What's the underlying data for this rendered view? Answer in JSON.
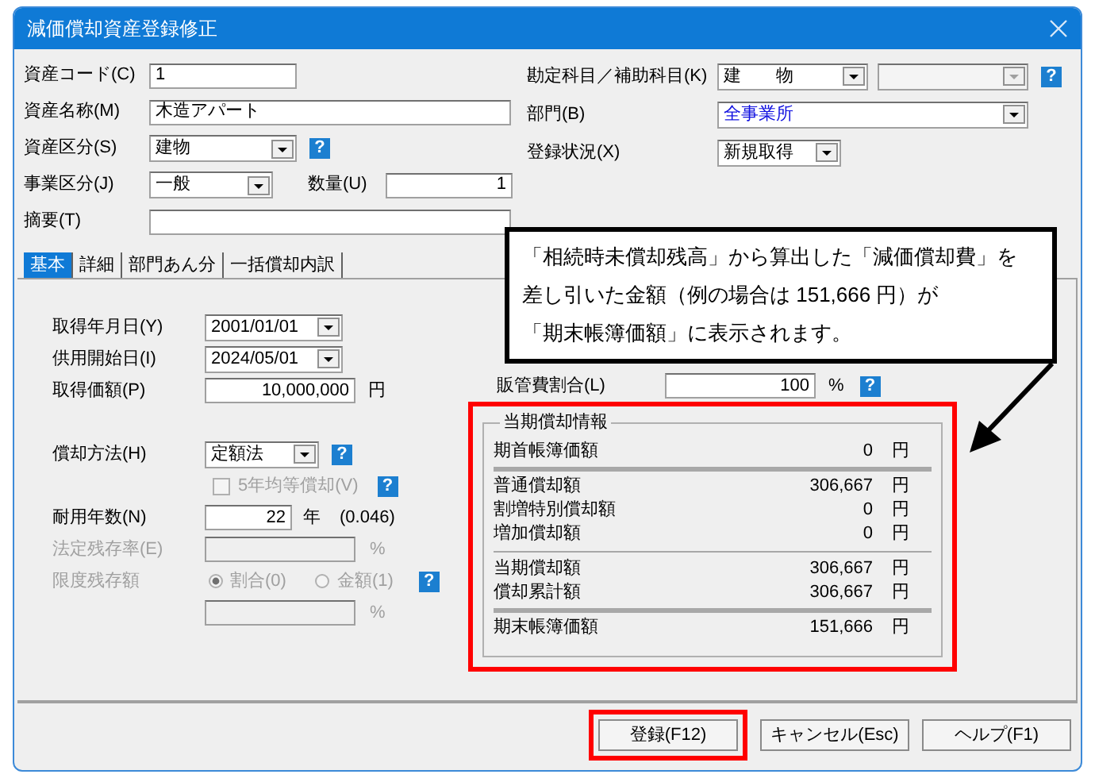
{
  "window": {
    "title": "減価償却資産登録修正"
  },
  "asset_code": {
    "label": "資産コード(C)",
    "value": "1"
  },
  "asset_name": {
    "label": "資産名称(M)",
    "value": "木造アパート"
  },
  "asset_class": {
    "label": "資産区分(S)",
    "value": "建物",
    "help": "?"
  },
  "business_class": {
    "label": "事業区分(J)",
    "value": "一般"
  },
  "quantity": {
    "label": "数量(U)",
    "value": "1"
  },
  "memo": {
    "label": "摘要(T)"
  },
  "account": {
    "label": "勘定科目／補助科目(K)",
    "value": "建　　物",
    "help": "?"
  },
  "sub_account": {
    "disabled": true
  },
  "department": {
    "label": "部門(B)",
    "value": "全事業所"
  },
  "status": {
    "label": "登録状況(X)",
    "value": "新規取得"
  },
  "tabs": [
    {
      "label": "基本",
      "selected": true
    },
    {
      "label": "詳細",
      "selected": false
    },
    {
      "label": "部門あん分",
      "selected": false
    },
    {
      "label": "一括償却内訳",
      "selected": false
    }
  ],
  "acquired_date": {
    "label": "取得年月日(Y)",
    "value": "2001/01/01"
  },
  "service_date": {
    "label": "供用開始日(I)",
    "value": "2024/05/01"
  },
  "acquired_price": {
    "label": "取得価額(P)",
    "value": "10,000,000",
    "unit": "円"
  },
  "method": {
    "label": "償却方法(H)",
    "value": "定額法",
    "help": "?"
  },
  "five_year": {
    "label": "5年均等償却(V)",
    "checked": false,
    "disabled": true,
    "help": "?"
  },
  "useful_life": {
    "label": "耐用年数(N)",
    "value": "22",
    "unit": "年",
    "rate": "(0.046)"
  },
  "legal_residual": {
    "label": "法定残存率(E)",
    "unit": "%",
    "disabled": true
  },
  "limit": {
    "label": "限度残存額",
    "disabled": true,
    "help": "?",
    "unit": "%",
    "options": [
      {
        "label": "割合(0)",
        "selected": true
      },
      {
        "label": "金額(1)",
        "selected": false
      }
    ]
  },
  "sales_ratio": {
    "label": "販管費割合(L)",
    "value": "100",
    "unit": "%",
    "help": "?"
  },
  "depreciation_info": {
    "title": "当期償却情報",
    "highlighted": true,
    "groups": [
      {
        "kind": "thick",
        "rows": [
          {
            "label": "期首帳簿価額",
            "value": "0",
            "unit": "円"
          }
        ]
      },
      {
        "kind": "thin",
        "rows": [
          {
            "label": "普通償却額",
            "value": "306,667",
            "unit": "円"
          },
          {
            "label": "割増特別償却額",
            "value": "0",
            "unit": "円"
          },
          {
            "label": "増加償却額",
            "value": "0",
            "unit": "円"
          }
        ]
      },
      {
        "kind": "thick",
        "rows": [
          {
            "label": "当期償却額",
            "value": "306,667",
            "unit": "円"
          },
          {
            "label": "償却累計額",
            "value": "306,667",
            "unit": "円"
          }
        ]
      },
      {
        "kind": "plain",
        "rows": [
          {
            "label": "期末帳簿価額",
            "value": "151,666",
            "unit": "円"
          }
        ]
      }
    ]
  },
  "callout": {
    "lines": [
      "「相続時未償却残高」から算出した「減価償却費」を",
      "差し引いた金額（例の場合は 151,666 円）が",
      "「期末帳簿価額」に表示されます。"
    ]
  },
  "buttons": [
    {
      "label": "登録(F12)",
      "highlighted": true
    },
    {
      "label": "キャンセル(Esc)",
      "highlighted": false
    },
    {
      "label": "ヘルプ(F1)",
      "highlighted": false
    }
  ]
}
